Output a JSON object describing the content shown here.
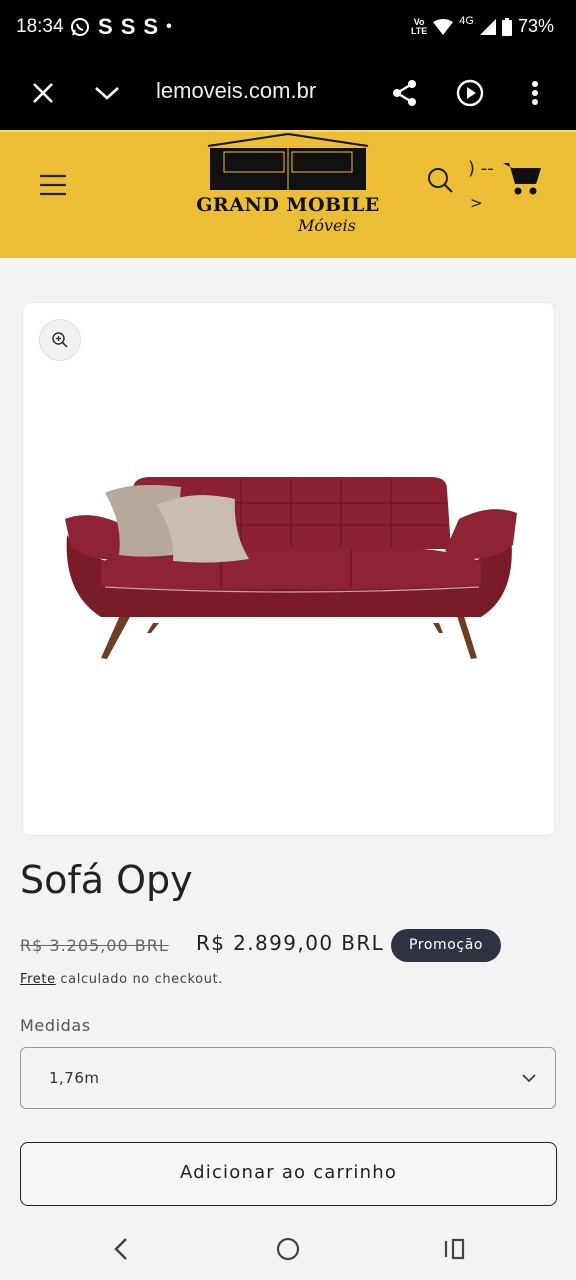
{
  "status_bar": {
    "time": "18:34",
    "notification_icons": [
      "whatsapp-icon",
      "S",
      "S",
      "S",
      "•"
    ],
    "volte_label": "Vo\nLTE",
    "network": "4G",
    "battery": "73%"
  },
  "browser": {
    "url": "lemoveis.com.br"
  },
  "site_header": {
    "brand_name": "GRAND MOBILE",
    "brand_sub": "Móveis",
    "cart_glyphs": ") --",
    "cart_arrow": ">",
    "colors": {
      "header_bg": "#ebbe36"
    }
  },
  "product": {
    "title": "Sofá Opy",
    "price_old": "R$ 3.205,00 BRL",
    "price_new": "R$ 2.899,00 BRL",
    "badge": "Promoção",
    "shipping_link": "Frete",
    "shipping_text": " calculado no checkout.",
    "option_label": "Medidas",
    "option_value": "1,76m",
    "add_to_cart": "Adicionar ao carrinho"
  }
}
